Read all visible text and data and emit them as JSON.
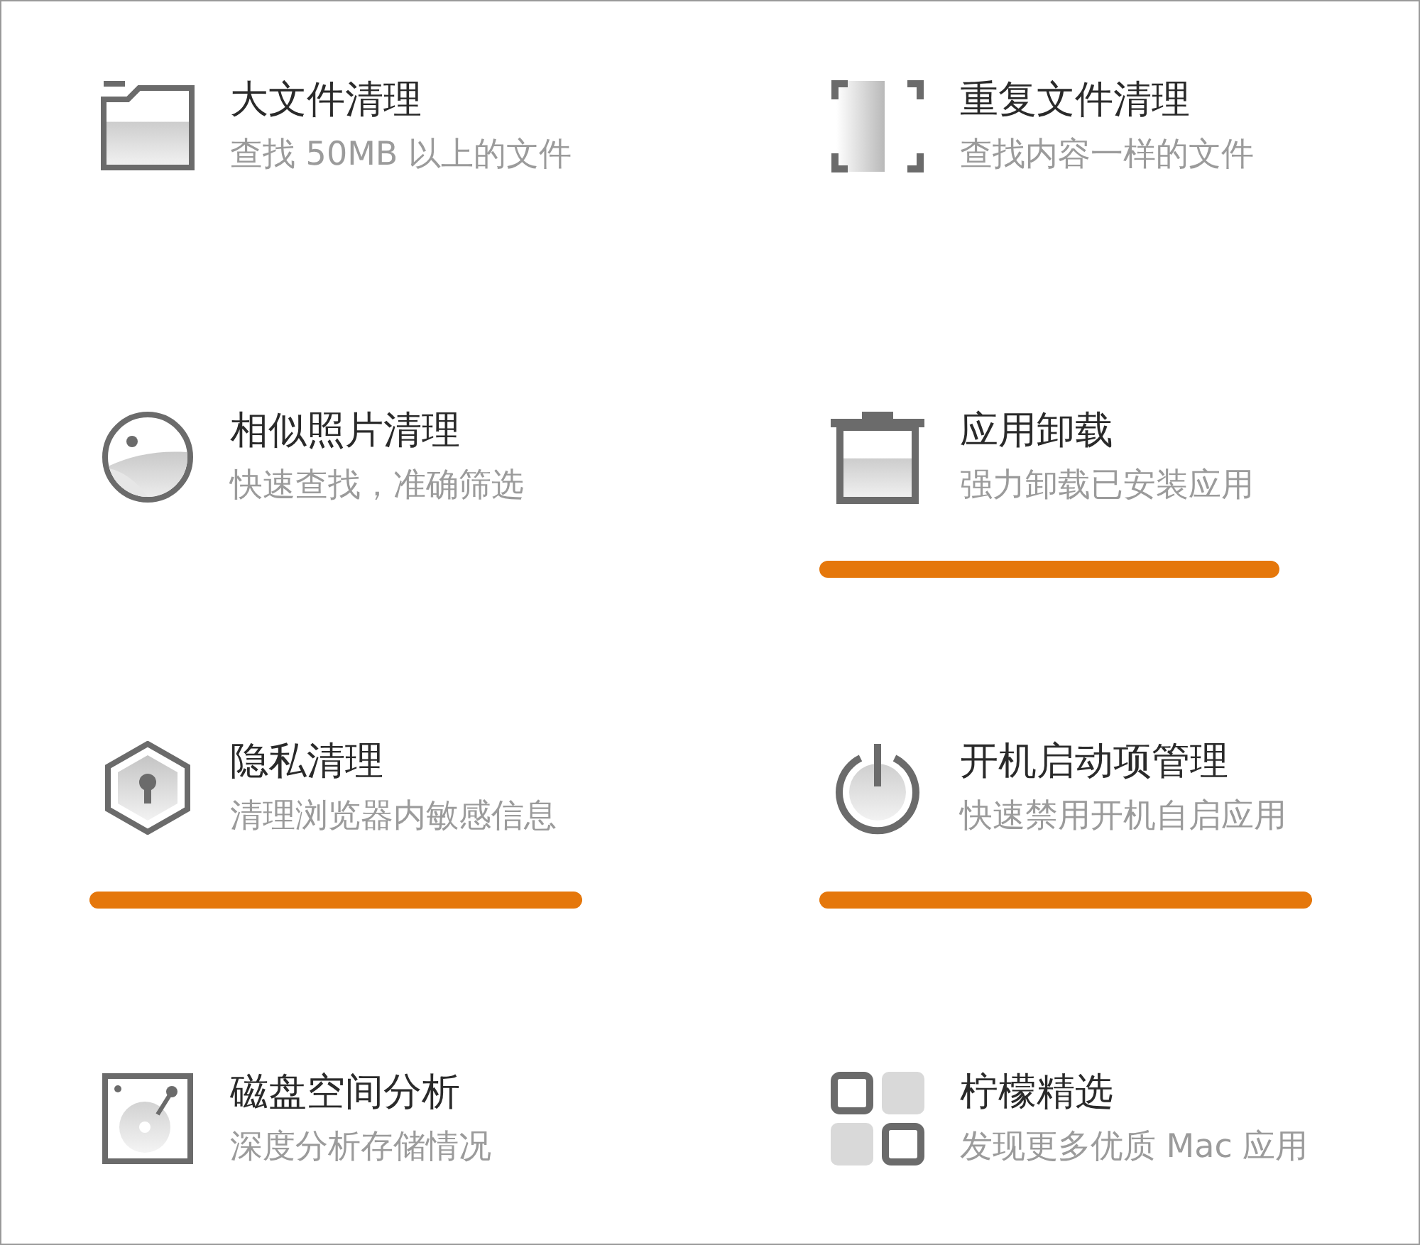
{
  "features": [
    {
      "title": "大文件清理",
      "description": "查找 50MB 以上的文件",
      "underlined": false
    },
    {
      "title": "重复文件清理",
      "description": "查找内容一样的文件",
      "underlined": false
    },
    {
      "title": "相似照片清理",
      "description": "快速查找，准确筛选",
      "underlined": false
    },
    {
      "title": "应用卸载",
      "description": "强力卸载已安装应用",
      "underlined": true
    },
    {
      "title": "隐私清理",
      "description": "清理浏览器内敏感信息",
      "underlined": true
    },
    {
      "title": "开机启动项管理",
      "description": "快速禁用开机自启应用",
      "underlined": true
    },
    {
      "title": "磁盘空间分析",
      "description": "深度分析存储情况",
      "underlined": false
    },
    {
      "title": "柠檬精选",
      "description": "发现更多优质 Mac 应用",
      "underlined": false
    }
  ]
}
